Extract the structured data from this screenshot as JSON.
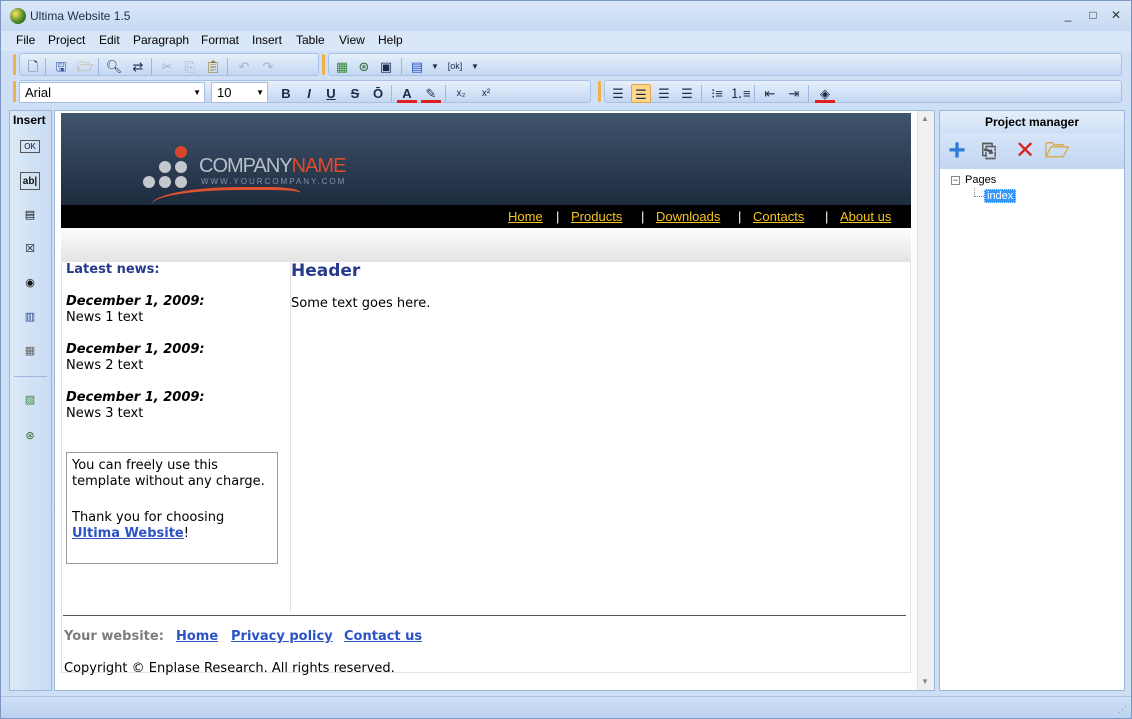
{
  "window": {
    "title": "Ultima Website 1.5",
    "controls": [
      "_",
      "□",
      "✕"
    ]
  },
  "menu": [
    "File",
    "Project",
    "Edit",
    "Paragraph",
    "Format",
    "Insert",
    "Table",
    "View",
    "Help"
  ],
  "format_toolbar": {
    "font": "Arial",
    "size": "10",
    "bold": "B",
    "italic": "I",
    "underline": "U",
    "strike": "S",
    "overline": "Ō",
    "font_color": "A",
    "subscript": "x₂",
    "superscript": "x²"
  },
  "insert_panel": {
    "title": "Insert"
  },
  "site": {
    "logo": {
      "company": "COMPANY",
      "name": "NAME",
      "tagline": "WWW.YOURCOMPANY.COM"
    },
    "nav": [
      "Home",
      "Products",
      "Downloads",
      "Contacts",
      "About us"
    ],
    "nav_sep": "|",
    "news_title": "Latest news:",
    "news": [
      {
        "date": "December 1, 2009:",
        "text": "News 1 text"
      },
      {
        "date": "December 1, 2009:",
        "text": "News 2 text"
      },
      {
        "date": "December 1, 2009:",
        "text": "News 3 text"
      }
    ],
    "notice": {
      "line1": "You can freely use this template without any charge.",
      "line2": "Thank you for choosing",
      "link": "Ultima Website",
      "suffix": "!"
    },
    "main_header": "Header",
    "main_text": "Some text goes here.",
    "footer": {
      "label": "Your website:",
      "links": [
        "Home",
        "Privacy policy",
        "Contact us"
      ],
      "copyright": "Copyright © Enplase Research. All rights reserved."
    }
  },
  "project_manager": {
    "title": "Project manager",
    "tree_root": "Pages",
    "tree_toggle": "−",
    "tree_item": "index"
  },
  "colors": {
    "nav_link": "#f6c41b",
    "heading_blue": "#283a8a",
    "link_blue": "#2b53c6",
    "logo_red": "#e04a2d"
  }
}
